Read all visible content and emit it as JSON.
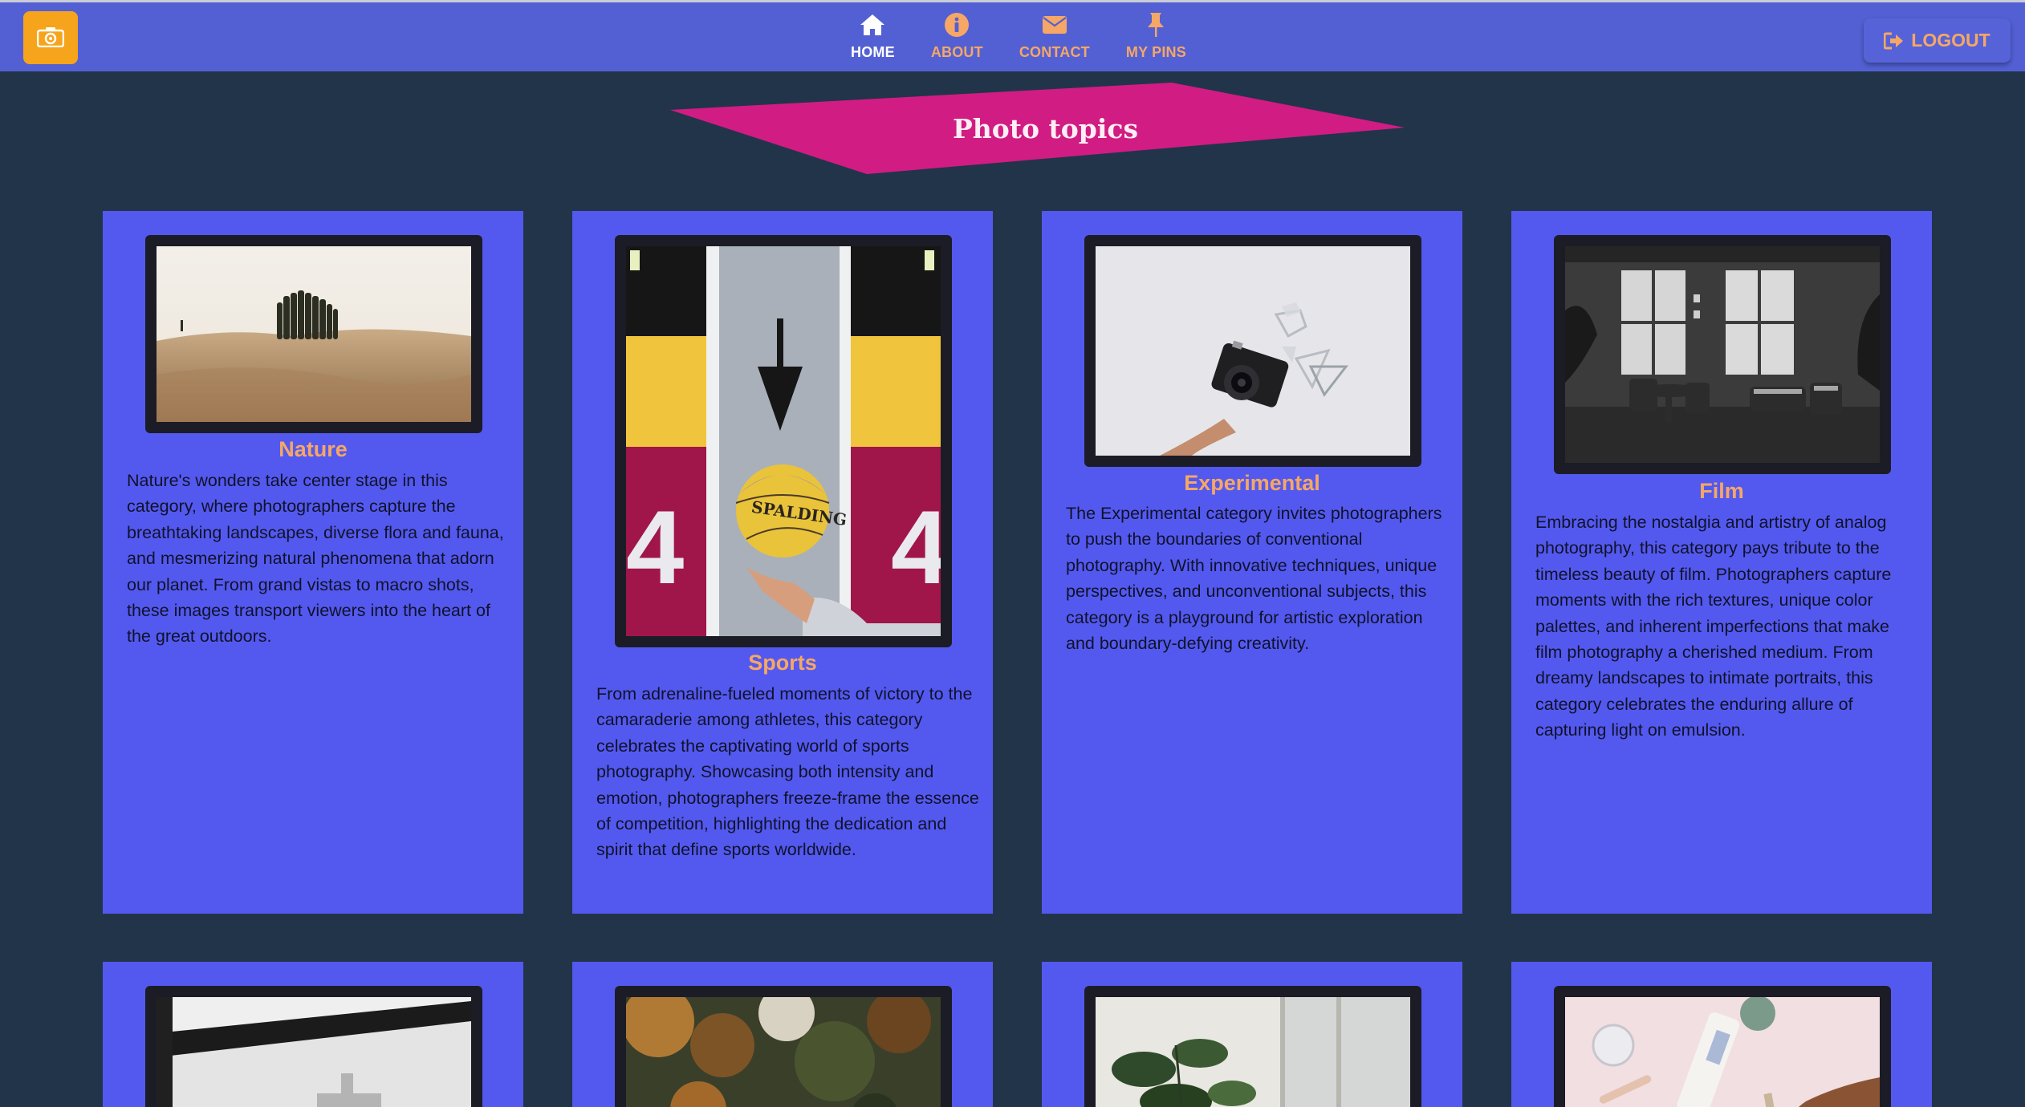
{
  "nav": {
    "items": [
      {
        "label": "HOME",
        "icon": "home-icon"
      },
      {
        "label": "ABOUT",
        "icon": "info-icon"
      },
      {
        "label": "CONTACT",
        "icon": "envelope-icon"
      },
      {
        "label": "MY PINS",
        "icon": "pin-icon"
      }
    ],
    "logout_label": "LOGOUT",
    "brand_icon": "camera-icon"
  },
  "banner": {
    "title": "Photo topics"
  },
  "topics": [
    {
      "title": "Nature",
      "description": "Nature's wonders take center stage in this category, where photographers capture the breathtaking landscapes, diverse flora and fauna, and mesmerizing natural phenomena that adorn our planet. From grand vistas to macro shots, these images transport viewers into the heart of the great outdoors."
    },
    {
      "title": "Sports",
      "description": "From adrenaline-fueled moments of victory to the camaraderie among athletes, this category celebrates the captivating world of sports photography. Showcasing both intensity and emotion, photographers freeze-frame the essence of competition, highlighting the dedication and spirit that define sports worldwide."
    },
    {
      "title": "Experimental",
      "description": "The Experimental category invites photographers to push the boundaries of conventional photography. With innovative techniques, unique perspectives, and unconventional subjects, this category is a playground for artistic exploration and boundary-defying creativity."
    },
    {
      "title": "Film",
      "description": "Embracing the nostalgia and artistry of analog photography, this category pays tribute to the timeless beauty of film. Photographers capture moments with the rich textures, unique color palettes, and inherent imperfections that make film photography a cherished medium. From dreamy landscapes to intimate portraits, this category celebrates the enduring allure of capturing light on emulsion."
    }
  ],
  "colors": {
    "background": "#22344a",
    "navbar": "#5360d3",
    "card": "#5359ee",
    "accent": "#f6a766",
    "banner": "#d11c83",
    "brand": "#f6a41b"
  }
}
